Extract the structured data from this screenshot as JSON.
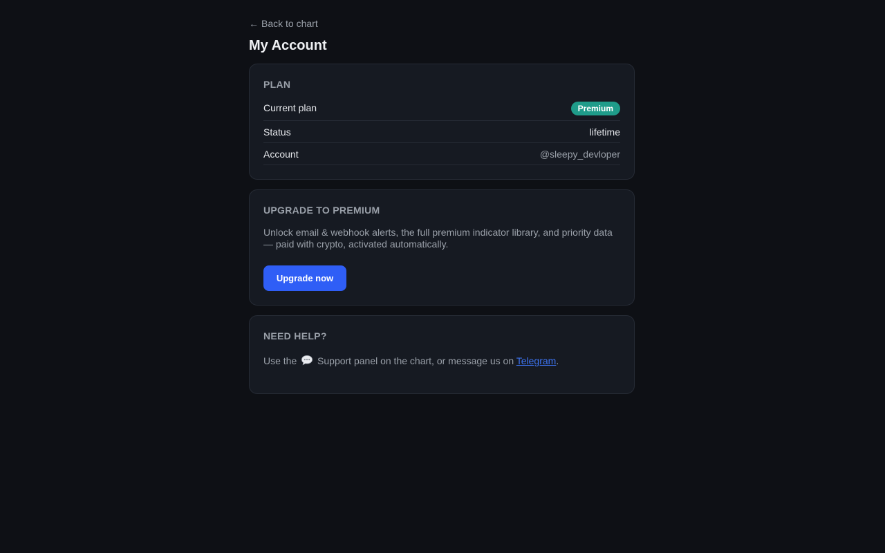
{
  "nav": {
    "back_arrow": "←",
    "back_label": "Back to chart"
  },
  "page": {
    "title": "My Account"
  },
  "plan": {
    "section_title": "PLAN",
    "rows": [
      {
        "label": "Current plan",
        "value": "Premium"
      },
      {
        "label": "Status",
        "value": "lifetime"
      },
      {
        "label": "Account",
        "value": "@sleepy_devloper"
      }
    ],
    "badge_color": "#1f9c8a"
  },
  "upgrade": {
    "section_title": "UPGRADE TO PREMIUM",
    "description": "Unlock email & webhook alerts, the full premium indicator library, and priority data — paid with crypto, activated automatically.",
    "button_label": "Upgrade now",
    "button_color": "#2f5ef6"
  },
  "help": {
    "section_title": "NEED HELP?",
    "text_before": "Use the",
    "icon": "speech-bubble-icon",
    "text_middle": "Support panel on the chart, or message us on",
    "link_label": "Telegram",
    "text_after": "."
  }
}
